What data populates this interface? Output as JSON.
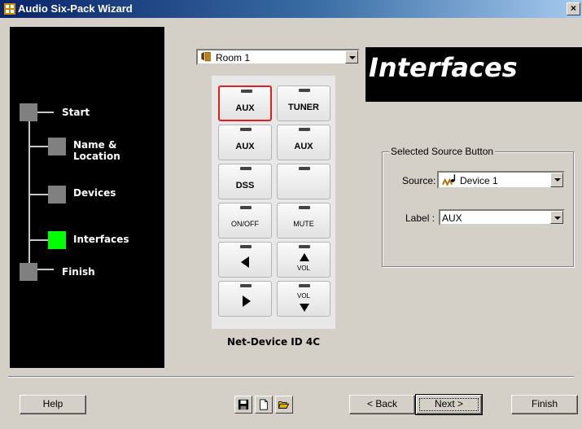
{
  "window": {
    "title": "Audio Six-Pack Wizard",
    "close_glyph": "×"
  },
  "steps": [
    {
      "label": "Start",
      "active": false
    },
    {
      "label": "Name & Location",
      "active": false
    },
    {
      "label": "Devices",
      "active": false
    },
    {
      "label": "Interfaces",
      "active": true
    },
    {
      "label": "Finish",
      "active": false
    }
  ],
  "room_select": {
    "value": "Room 1",
    "icon": "room-door-icon"
  },
  "heading": "Interfaces",
  "remote": {
    "buttons": [
      {
        "label": "AUX",
        "selected": true
      },
      {
        "label": "TUNER"
      },
      {
        "label": "AUX"
      },
      {
        "label": "AUX"
      },
      {
        "label": "DSS"
      },
      {
        "label": ""
      },
      {
        "label": "ON/OFF"
      },
      {
        "label": "MUTE"
      },
      {
        "label": "",
        "icon": "arrow-left-icon"
      },
      {
        "label": "VOL",
        "icon": "volume-up-icon"
      },
      {
        "label": "",
        "icon": "arrow-right-icon"
      },
      {
        "label": "VOL",
        "icon": "volume-down-icon"
      }
    ],
    "device_id": "Net-Device ID 4C"
  },
  "source_group": {
    "legend": "Selected Source Button",
    "source_label": "Source:",
    "source_value": "Device 1",
    "source_icon": "device-note-icon",
    "label_label": "Label :",
    "label_value": "AUX"
  },
  "footer": {
    "help": "Help",
    "back": "< Back",
    "next": "Next >",
    "finish": "Finish",
    "icons": [
      "save-icon",
      "new-icon",
      "open-icon"
    ]
  },
  "colors": {
    "active_step": "#00ff00",
    "selected_button_border": "#e02020"
  }
}
